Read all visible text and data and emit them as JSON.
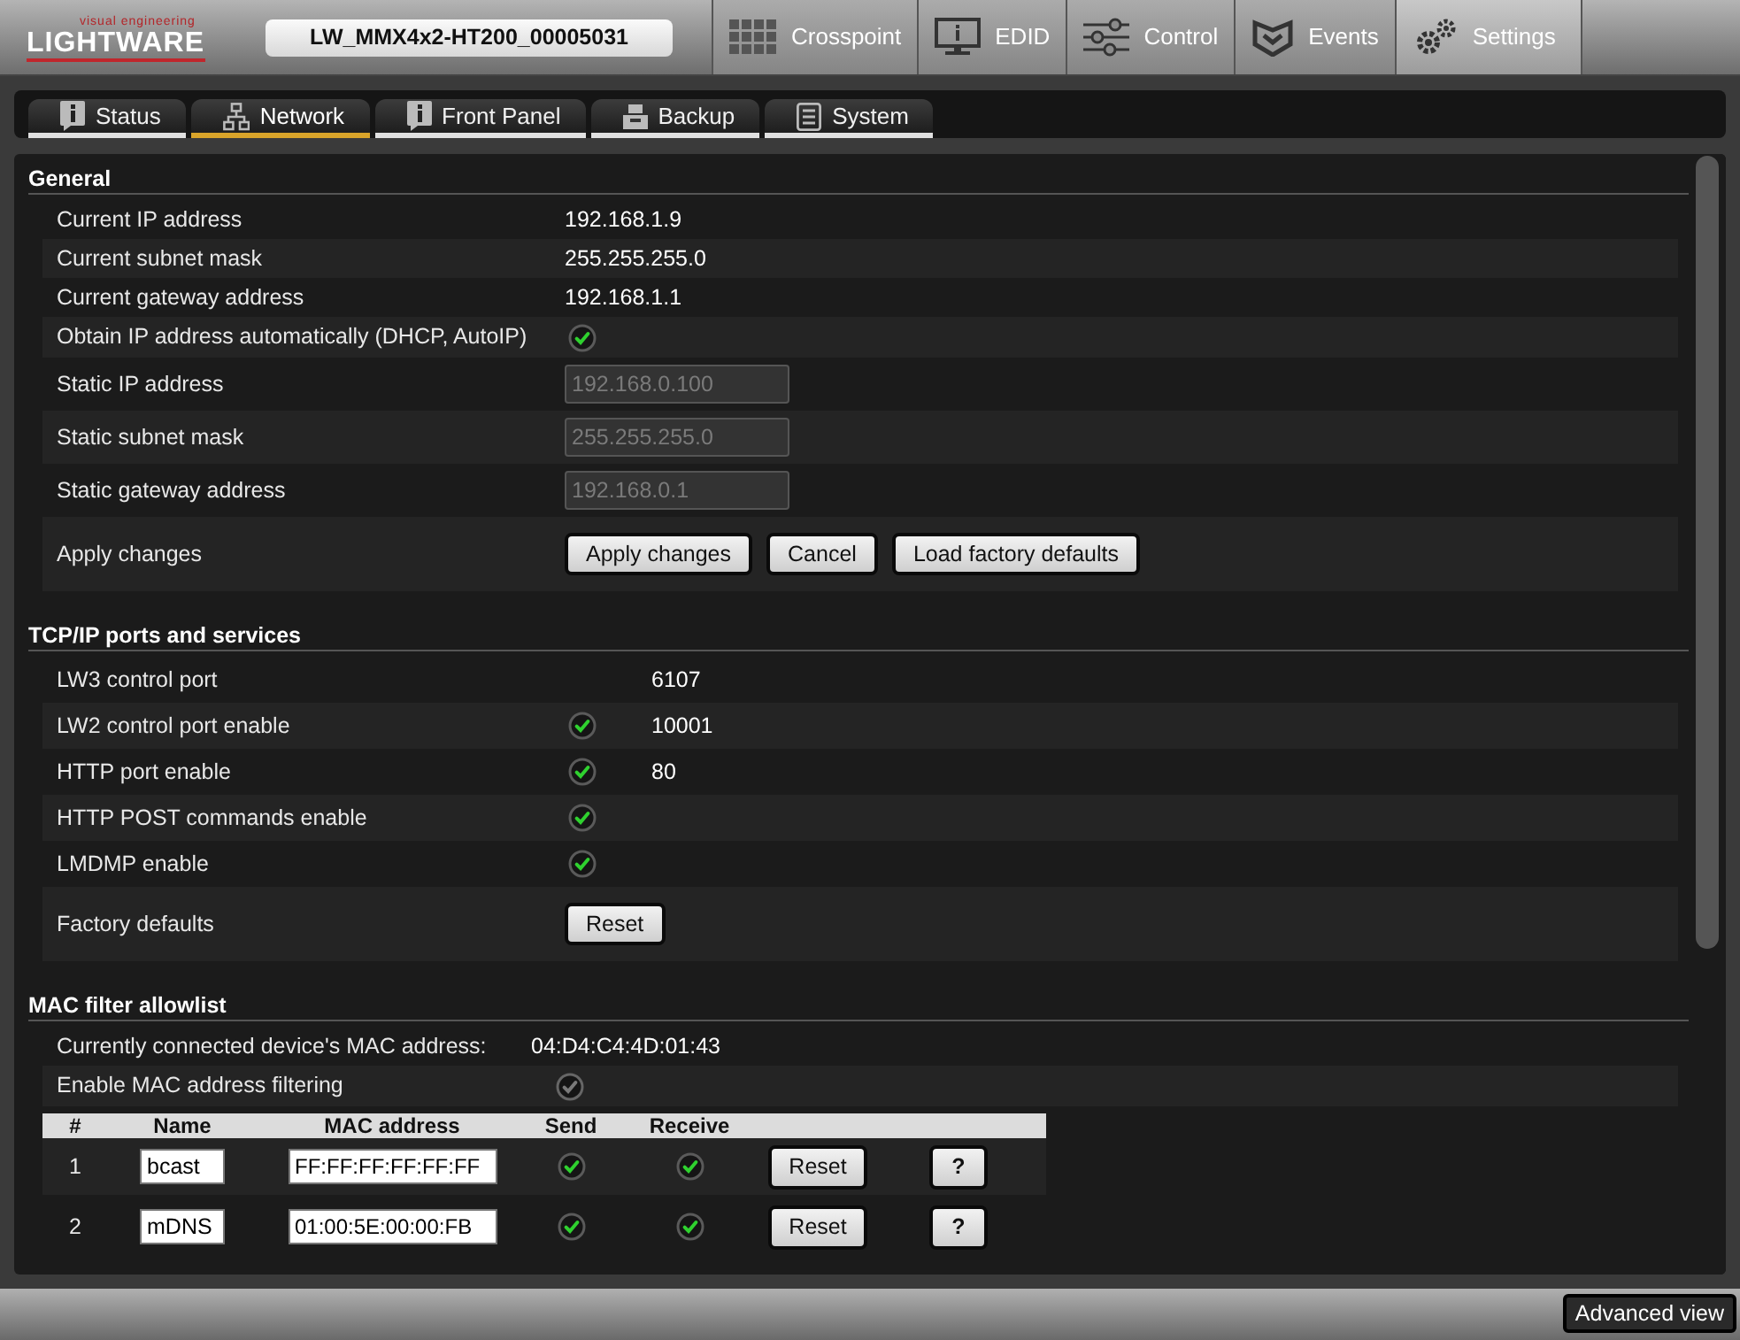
{
  "header": {
    "logo": {
      "tagline": "visual engineering",
      "brand": "LIGHTWARE"
    },
    "device_name": "LW_MMX4x2-HT200_00005031",
    "nav": [
      {
        "label": "Crosspoint",
        "kind": "grid",
        "selected": false
      },
      {
        "label": "EDID",
        "kind": "monitor",
        "selected": false
      },
      {
        "label": "Control",
        "kind": "sliders",
        "selected": false
      },
      {
        "label": "Events",
        "kind": "events",
        "selected": false
      },
      {
        "label": "Settings",
        "kind": "gears",
        "selected": true
      }
    ]
  },
  "subtabs": [
    {
      "label": "Status",
      "kind": "info",
      "selected": false
    },
    {
      "label": "Network",
      "kind": "network",
      "selected": true
    },
    {
      "label": "Front Panel",
      "kind": "info",
      "selected": false
    },
    {
      "label": "Backup",
      "kind": "drawer",
      "selected": false
    },
    {
      "label": "System",
      "kind": "list",
      "selected": false
    }
  ],
  "sections": [
    {
      "title": "General",
      "rows": [
        {
          "kind": "text",
          "label": "Current IP address",
          "value": "192.168.1.9"
        },
        {
          "kind": "text",
          "label": "Current subnet mask",
          "value": "255.255.255.0"
        },
        {
          "kind": "text",
          "label": "Current gateway address",
          "value": "192.168.1.1"
        },
        {
          "kind": "check",
          "label": "Obtain IP address automatically (DHCP, AutoIP)",
          "checked": true
        },
        {
          "kind": "input",
          "label": "Static IP address",
          "value": "192.168.0.100",
          "disabled": true
        },
        {
          "kind": "input",
          "label": "Static subnet mask",
          "value": "255.255.255.0",
          "disabled": true
        },
        {
          "kind": "input",
          "label": "Static gateway address",
          "value": "192.168.0.1",
          "disabled": true
        },
        {
          "kind": "buttons",
          "label": "Apply changes",
          "buttons": [
            "Apply changes",
            "Cancel",
            "Load factory defaults"
          ]
        }
      ]
    },
    {
      "title": "TCP/IP ports and services",
      "rows": [
        {
          "kind": "port",
          "label": "LW3 control port",
          "value": "6107"
        },
        {
          "kind": "port",
          "label": "LW2 control port enable",
          "checked": true,
          "value": "10001"
        },
        {
          "kind": "port",
          "label": "HTTP port enable",
          "checked": true,
          "value": "80"
        },
        {
          "kind": "port",
          "label": "HTTP POST commands enable",
          "checked": true
        },
        {
          "kind": "port",
          "label": "LMDMP enable",
          "checked": true
        },
        {
          "kind": "buttons",
          "label": "Factory defaults",
          "buttons": [
            "Reset"
          ]
        }
      ]
    },
    {
      "title": "MAC filter allowlist",
      "rows": [
        {
          "kind": "mac_info",
          "label": "Currently connected device's MAC address:",
          "value": "04:D4:C4:4D:01:43"
        },
        {
          "kind": "mac_check",
          "label": "Enable MAC address filtering",
          "checked": false
        }
      ],
      "table": {
        "columns": [
          "#",
          "Name",
          "MAC address",
          "Send",
          "Receive"
        ],
        "rows": [
          {
            "number": "1",
            "name": "bcast",
            "mac": "FF:FF:FF:FF:FF:FF",
            "send": true,
            "receive": true,
            "reset": "Reset",
            "help": "?"
          },
          {
            "number": "2",
            "name": "mDNS",
            "mac": "01:00:5E:00:00:FB",
            "send": true,
            "receive": true,
            "reset": "Reset",
            "help": "?"
          }
        ]
      }
    }
  ],
  "footer": {
    "button": "Advanced view"
  }
}
